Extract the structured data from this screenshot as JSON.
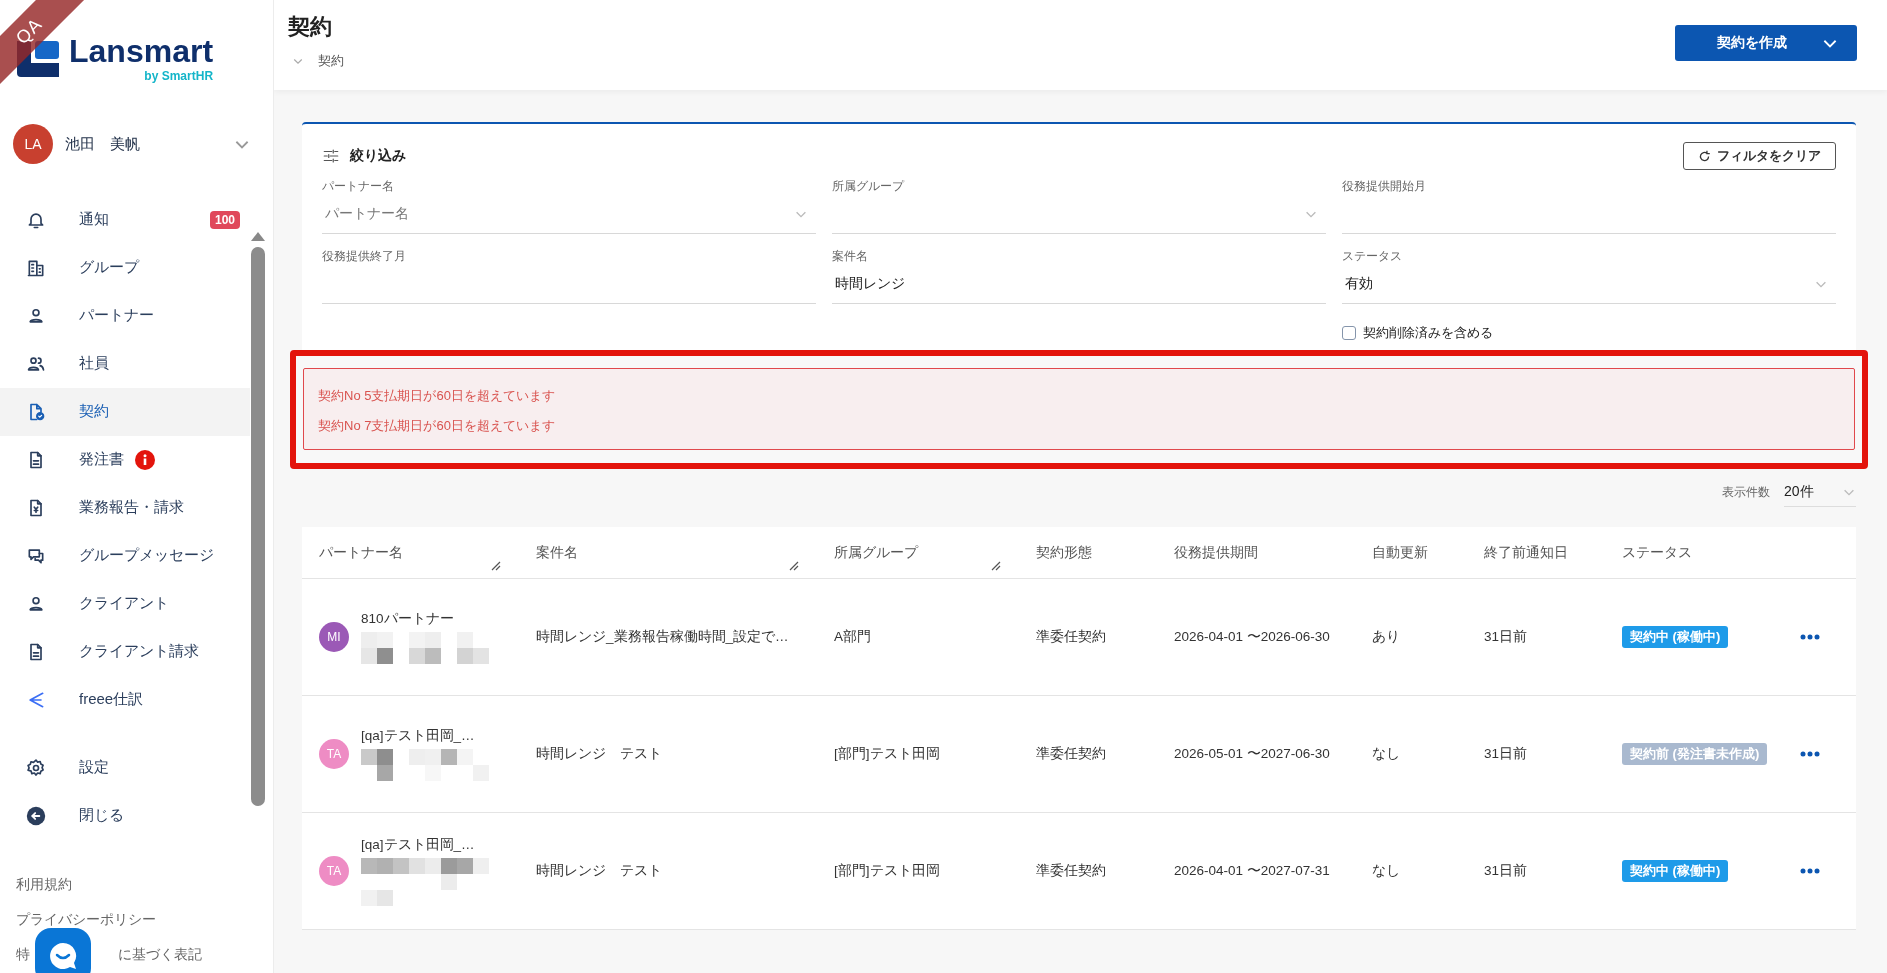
{
  "environment_badge": "QA",
  "sidebar": {
    "logo": {
      "name": "Lansmart",
      "byline": "by SmartHR"
    },
    "user": {
      "initials": "LA",
      "name": "池田　美帆"
    },
    "nav": [
      {
        "label": "通知",
        "badge": "100",
        "alert": false,
        "selected": false
      },
      {
        "label": "グループ",
        "alert": false,
        "selected": false
      },
      {
        "label": "パートナー",
        "alert": false,
        "selected": false
      },
      {
        "label": "社員",
        "alert": false,
        "selected": false
      },
      {
        "label": "契約",
        "alert": false,
        "selected": true
      },
      {
        "label": "発注書",
        "alert": true,
        "selected": false
      },
      {
        "label": "業務報告・請求",
        "alert": false,
        "selected": false
      },
      {
        "label": "グループメッセージ",
        "alert": false,
        "selected": false
      },
      {
        "label": "クライアント",
        "alert": false,
        "selected": false
      },
      {
        "label": "クライアント請求",
        "alert": false,
        "selected": false
      },
      {
        "label": "freee仕訳",
        "alert": false,
        "selected": false
      }
    ],
    "bottom_nav": [
      "設定",
      "閉じる"
    ],
    "footer_links": [
      "利用規約",
      "プライバシーポリシー"
    ],
    "covered_link_parts": [
      "特",
      "に基づく表記"
    ]
  },
  "page": {
    "title": "契約",
    "breadcrumb": "契約",
    "create_button": "契約を作成"
  },
  "filter": {
    "title": "絞り込み",
    "clear_button": "フィルタをクリア",
    "fields": [
      {
        "label": "パートナー名",
        "placeholder": "パートナー名",
        "kind": "select"
      },
      {
        "label": "所属グループ",
        "kind": "select"
      },
      {
        "label": "役務提供開始月",
        "kind": "text"
      },
      {
        "label": "役務提供終了月",
        "kind": "text"
      },
      {
        "label": "案件名",
        "value": "時間レンジ",
        "kind": "text"
      },
      {
        "label": "ステータス",
        "value": "有効",
        "kind": "select"
      }
    ],
    "checkbox": {
      "label": "契約削除済みを含める",
      "checked": false
    }
  },
  "alerts": {
    "highlighted": true,
    "messages": [
      "契約No 5支払期日が60日を超えています",
      "契約No 7支払期日が60日を超えています"
    ]
  },
  "page_size": {
    "label": "表示件数",
    "value": "20件"
  },
  "table": {
    "columns": [
      {
        "label": "パートナー名",
        "resizable": true
      },
      {
        "label": "案件名",
        "resizable": true
      },
      {
        "label": "所属グループ",
        "resizable": true
      },
      {
        "label": "契約形態",
        "resizable": false
      },
      {
        "label": "役務提供期間",
        "resizable": false
      },
      {
        "label": "自動更新",
        "resizable": false
      },
      {
        "label": "終了前通知日",
        "resizable": false
      },
      {
        "label": "ステータス",
        "resizable": false
      }
    ],
    "rows": [
      {
        "initials": "MI",
        "color": "#9b59b6",
        "partner": "810パートナー",
        "project": "時間レンジ_業務報告稼働時間_設定で…",
        "group": "A部門",
        "contract_type": "準委任契約",
        "period": "2026-04-01 〜2026-06-30",
        "auto_renew": "あり",
        "notice": "31日前",
        "status": {
          "label": "契約中 (稼働中)",
          "kind": "active"
        }
      },
      {
        "initials": "TA",
        "color": "#ee8cc4",
        "partner": "[qa]テスト田岡_…",
        "project": "時間レンジ　テスト",
        "group": "[部門]テスト田岡",
        "contract_type": "準委任契約",
        "period": "2026-05-01 〜2027-06-30",
        "auto_renew": "なし",
        "notice": "31日前",
        "status": {
          "label": "契約前 (発注書未作成)",
          "kind": "pending"
        }
      },
      {
        "initials": "TA",
        "color": "#ee8cc4",
        "partner": "[qa]テスト田岡_…",
        "project": "時間レンジ　テスト",
        "group": "[部門]テスト田岡",
        "contract_type": "準委任契約",
        "period": "2026-04-01 〜2027-07-31",
        "auto_renew": "なし",
        "notice": "31日前",
        "status": {
          "label": "契約中 (稼働中)",
          "kind": "active"
        }
      }
    ]
  }
}
